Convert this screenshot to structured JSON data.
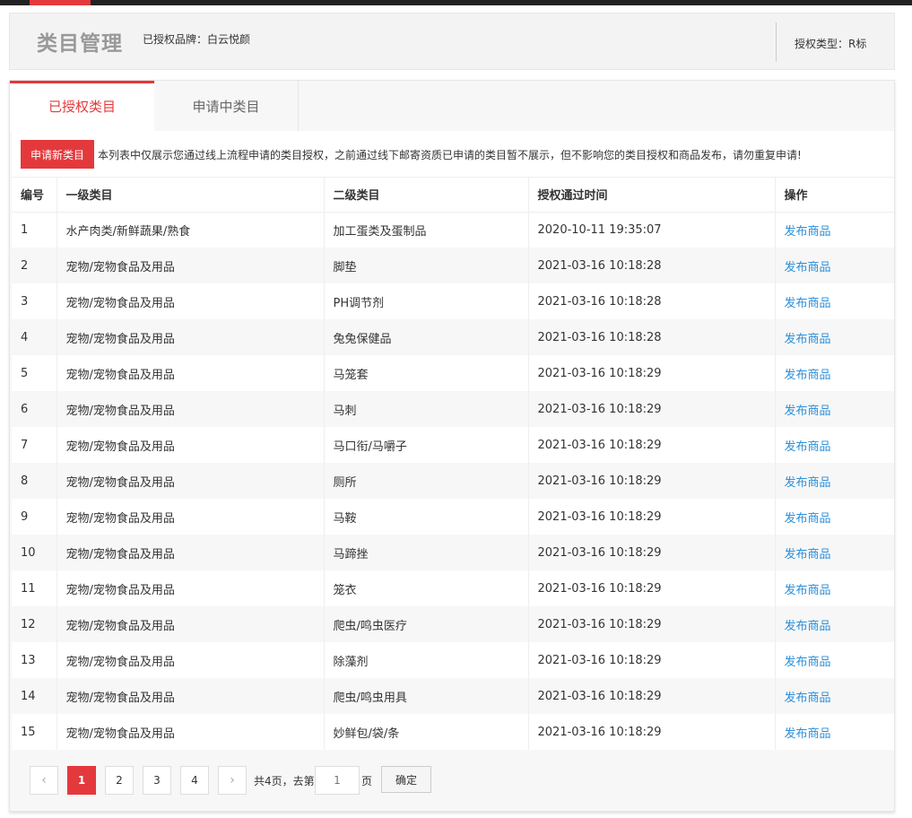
{
  "header": {
    "title": "类目管理",
    "brand_label": "已授权品牌：白云悦颜",
    "auth_type_label": "授权类型：R标"
  },
  "tabs": [
    {
      "label": "已授权类目",
      "active": true
    },
    {
      "label": "申请中类目",
      "active": false
    }
  ],
  "notice": {
    "apply_button": "申请新类目",
    "text": "本列表中仅展示您通过线上流程申请的类目授权，之前通过线下邮寄资质已申请的类目暂不展示，但不影响您的类目授权和商品发布，请勿重复申请!"
  },
  "table": {
    "columns": [
      "编号",
      "一级类目",
      "二级类目",
      "授权通过时间",
      "操作"
    ],
    "action_label": "发布商品",
    "rows": [
      {
        "id": "1",
        "level1": "水产肉类/新鲜蔬果/熟食",
        "level2": "加工蛋类及蛋制品",
        "time": "2020-10-11 19:35:07"
      },
      {
        "id": "2",
        "level1": "宠物/宠物食品及用品",
        "level2": "脚垫",
        "time": "2021-03-16 10:18:28"
      },
      {
        "id": "3",
        "level1": "宠物/宠物食品及用品",
        "level2": "PH调节剂",
        "time": "2021-03-16 10:18:28"
      },
      {
        "id": "4",
        "level1": "宠物/宠物食品及用品",
        "level2": "兔兔保健品",
        "time": "2021-03-16 10:18:28"
      },
      {
        "id": "5",
        "level1": "宠物/宠物食品及用品",
        "level2": "马笼套",
        "time": "2021-03-16 10:18:29"
      },
      {
        "id": "6",
        "level1": "宠物/宠物食品及用品",
        "level2": "马刺",
        "time": "2021-03-16 10:18:29"
      },
      {
        "id": "7",
        "level1": "宠物/宠物食品及用品",
        "level2": "马口衔/马嚼子",
        "time": "2021-03-16 10:18:29"
      },
      {
        "id": "8",
        "level1": "宠物/宠物食品及用品",
        "level2": "厕所",
        "time": "2021-03-16 10:18:29"
      },
      {
        "id": "9",
        "level1": "宠物/宠物食品及用品",
        "level2": "马鞍",
        "time": "2021-03-16 10:18:29"
      },
      {
        "id": "10",
        "level1": "宠物/宠物食品及用品",
        "level2": "马蹄挫",
        "time": "2021-03-16 10:18:29"
      },
      {
        "id": "11",
        "level1": "宠物/宠物食品及用品",
        "level2": "笼衣",
        "time": "2021-03-16 10:18:29"
      },
      {
        "id": "12",
        "level1": "宠物/宠物食品及用品",
        "level2": "爬虫/鸣虫医疗",
        "time": "2021-03-16 10:18:29"
      },
      {
        "id": "13",
        "level1": "宠物/宠物食品及用品",
        "level2": "除藻剂",
        "time": "2021-03-16 10:18:29"
      },
      {
        "id": "14",
        "level1": "宠物/宠物食品及用品",
        "level2": "爬虫/鸣虫用具",
        "time": "2021-03-16 10:18:29"
      },
      {
        "id": "15",
        "level1": "宠物/宠物食品及用品",
        "level2": "妙鲜包/袋/条",
        "time": "2021-03-16 10:18:29"
      }
    ]
  },
  "pagination": {
    "prev": "‹",
    "next": "›",
    "pages": [
      "1",
      "2",
      "3",
      "4"
    ],
    "current_page": 1,
    "total_text": "共4页，去第",
    "goto_value": "",
    "goto_placeholder": "1",
    "page_suffix": "页",
    "confirm_label": "确定"
  },
  "colors": {
    "accent": "#e4393c",
    "link": "#2b8fd9",
    "header_bg": "#f3f3f3"
  }
}
